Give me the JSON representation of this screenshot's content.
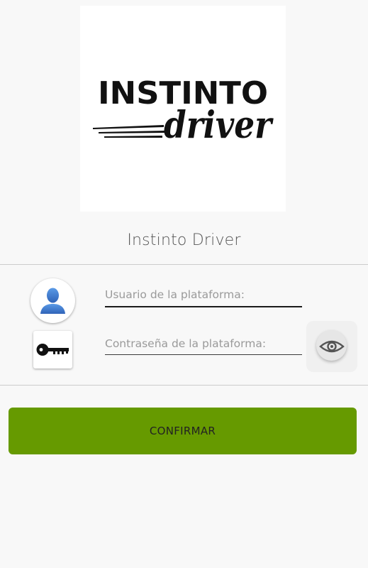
{
  "logo": {
    "word_top": "INSTINTO",
    "word_bottom": "driver",
    "color": "#111111"
  },
  "app": {
    "title": "Instinto Driver"
  },
  "form": {
    "username_placeholder": "Usuario de la plataforma:",
    "password_placeholder": "Contraseña de la plataforma:",
    "user_icon": "user-silhouette-icon",
    "key_icon": "key-icon",
    "toggle_icon": "eye-icon"
  },
  "actions": {
    "confirm_label": "CONFIRMAR"
  },
  "colors": {
    "accent": "#669a00",
    "avatar_blue": "#3f7fd0",
    "background": "#f8f8f8"
  }
}
